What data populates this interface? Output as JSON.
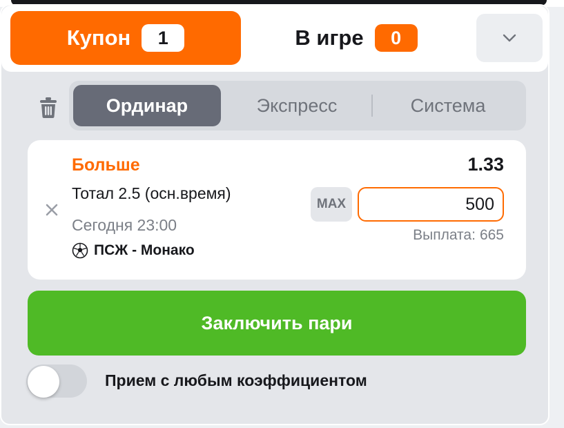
{
  "header": {
    "tabs": [
      {
        "label": "Купон",
        "count": "1",
        "active": true
      },
      {
        "label": "В игре",
        "count": "0",
        "active": false
      }
    ],
    "collapse_icon": "chevron-down-icon"
  },
  "toolbar": {
    "trash_icon": "trash-icon",
    "bet_types": [
      {
        "label": "Ординар",
        "active": true
      },
      {
        "label": "Экспресс",
        "active": false
      },
      {
        "label": "Система",
        "active": false
      }
    ]
  },
  "bet": {
    "outcome": "Больше",
    "market": "Тотал 2.5 (осн.время)",
    "datetime": "Сегодня 23:00",
    "match": "ПСЖ - Монако",
    "sport_icon": "soccer-ball-icon",
    "odds": "1.33",
    "max_label": "MAX",
    "stake": "500",
    "payout_label": "Выплата:",
    "payout_value": "665"
  },
  "actions": {
    "place_bet_label": "Заключить пари",
    "accept_any_odds_label": "Прием с любым коэффициентом",
    "accept_any_odds_enabled": false
  },
  "colors": {
    "accent": "#ff6a00",
    "success": "#4fba26",
    "segment_active": "#676b77",
    "panel_bg": "#e4e6ea"
  }
}
